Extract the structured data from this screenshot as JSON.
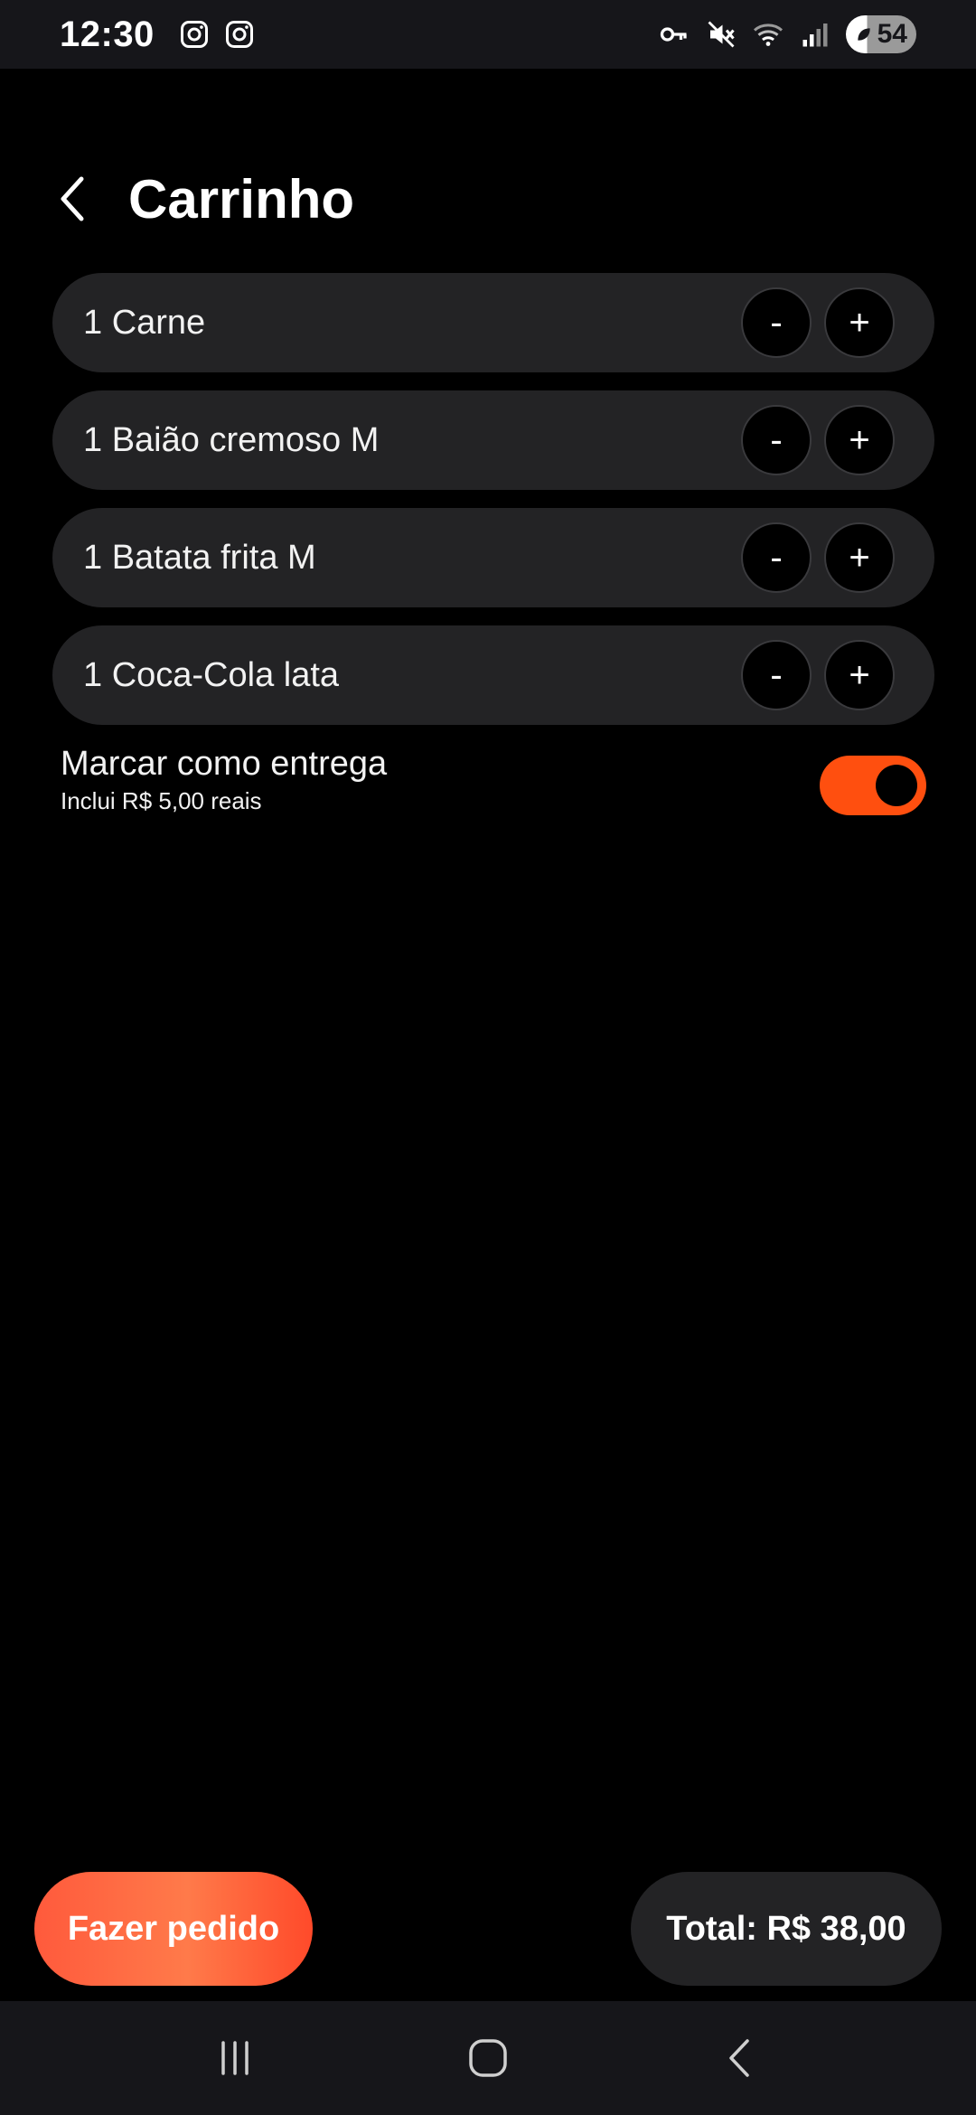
{
  "status_bar": {
    "time": "12:30",
    "left_icons": [
      "instagram-icon",
      "instagram-icon"
    ],
    "right_icons": [
      "vpn-key-icon",
      "mute-icon",
      "wifi-icon",
      "signal-icon"
    ],
    "battery_level": "54"
  },
  "header": {
    "title": "Carrinho"
  },
  "cart": {
    "items": [
      {
        "label": "1 Carne",
        "minus": "-",
        "plus": "+"
      },
      {
        "label": "1 Baião cremoso M",
        "minus": "-",
        "plus": "+"
      },
      {
        "label": "1 Batata frita M",
        "minus": "-",
        "plus": "+"
      },
      {
        "label": "1 Coca-Cola lata",
        "minus": "-",
        "plus": "+"
      }
    ]
  },
  "delivery": {
    "title": "Marcar como entrega",
    "subtitle": "Inclui R$ 5,00 reais",
    "enabled": true
  },
  "footer": {
    "order_button": "Fazer pedido",
    "total": "Total: R$ 38,00"
  },
  "colors": {
    "accent": "#ff4f0f",
    "background": "#000000",
    "card": "#232325"
  }
}
